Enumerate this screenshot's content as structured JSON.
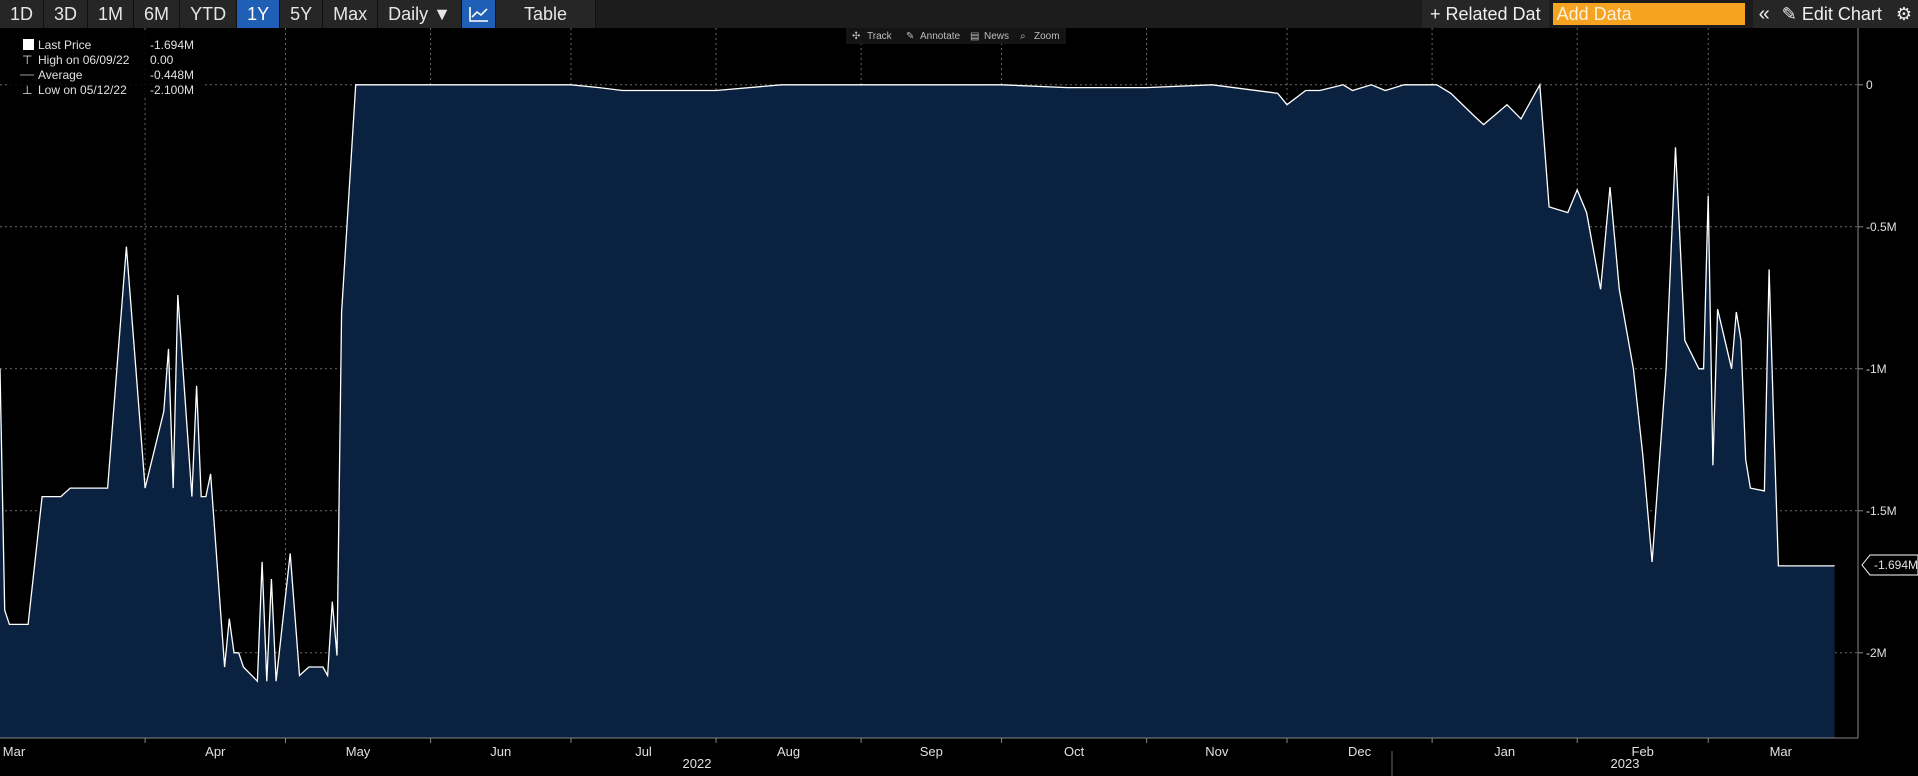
{
  "toolbar": {
    "ranges": [
      "1D",
      "3D",
      "1M",
      "6M",
      "YTD",
      "1Y",
      "5Y",
      "Max"
    ],
    "active_range": "1Y",
    "frequency": "Daily",
    "frequency_arrow": "▼",
    "table_label": "Table",
    "related_label": "+ Related Dat",
    "add_data_placeholder": "Add Data",
    "collapse_icon": "«",
    "edit_chart_label": "Edit Chart",
    "edit_icon": "✎",
    "gear_icon": "⚙"
  },
  "chart_tools": [
    "Track",
    "Annotate",
    "News",
    "Zoom"
  ],
  "legend": {
    "rows": [
      {
        "label": "Last Price",
        "value": "-1.694M"
      },
      {
        "label": "High on 06/09/22",
        "value": "0.00"
      },
      {
        "label": "Average",
        "value": "-0.448M"
      },
      {
        "label": "Low on 05/12/22",
        "value": "-2.100M"
      }
    ]
  },
  "colors": {
    "background": "#000000",
    "area_fill": "#0a2240",
    "line": "#ffffff",
    "grid": "#6a6a6a",
    "accent": "#1f5fb5",
    "add_data": "#f5a320"
  },
  "chart_data": {
    "type": "area",
    "series": [
      {
        "name": "Last Price",
        "x": [
          "2022-03-01",
          "2022-03-02",
          "2022-03-03",
          "2022-03-07",
          "2022-03-10",
          "2022-03-14",
          "2022-03-16",
          "2022-03-21",
          "2022-03-24",
          "2022-03-28",
          "2022-04-01",
          "2022-04-05",
          "2022-04-06",
          "2022-04-07",
          "2022-04-08",
          "2022-04-11",
          "2022-04-12",
          "2022-04-13",
          "2022-04-14",
          "2022-04-15",
          "2022-04-18",
          "2022-04-19",
          "2022-04-20",
          "2022-04-21",
          "2022-04-22",
          "2022-04-25",
          "2022-04-26",
          "2022-04-27",
          "2022-04-28",
          "2022-04-29",
          "2022-05-02",
          "2022-05-04",
          "2022-05-06",
          "2022-05-09",
          "2022-05-10",
          "2022-05-11",
          "2022-05-12",
          "2022-05-13",
          "2022-05-16",
          "2022-05-17",
          "2022-05-18",
          "2022-05-19",
          "2022-05-20",
          "2022-05-23",
          "2022-05-24",
          "2022-05-25",
          "2022-05-26",
          "2022-05-27",
          "2022-05-31",
          "2022-06-01",
          "2022-06-02",
          "2022-06-03",
          "2022-06-06",
          "2022-06-09",
          "2022-07-01",
          "2022-07-07",
          "2022-07-12",
          "2022-08-01",
          "2022-08-15",
          "2022-09-01",
          "2022-09-15",
          "2022-10-01",
          "2022-10-15",
          "2022-11-01",
          "2022-11-15",
          "2022-11-29",
          "2022-12-01",
          "2022-12-05",
          "2022-12-08",
          "2022-12-13",
          "2022-12-15",
          "2022-12-19",
          "2022-12-22",
          "2022-12-26",
          "2022-12-29",
          "2023-01-02",
          "2023-01-05",
          "2023-01-10",
          "2023-01-12",
          "2023-01-17",
          "2023-01-20",
          "2023-01-24",
          "2023-01-26",
          "2023-01-30",
          "2023-02-01",
          "2023-02-03",
          "2023-02-06",
          "2023-02-08",
          "2023-02-10",
          "2023-02-13",
          "2023-02-15",
          "2023-02-17",
          "2023-02-20",
          "2023-02-22",
          "2023-02-24",
          "2023-02-27",
          "2023-02-28",
          "2023-03-01",
          "2023-03-02",
          "2023-03-03",
          "2023-03-06",
          "2023-03-07",
          "2023-03-08",
          "2023-03-09",
          "2023-03-10",
          "2023-03-13",
          "2023-03-14",
          "2023-03-15",
          "2023-03-16",
          "2023-03-17",
          "2023-03-20",
          "2023-03-21",
          "2023-03-22",
          "2023-03-23",
          "2023-03-24",
          "2023-03-27",
          "2023-03-28"
        ],
        "values": [
          -1.0,
          -1.85,
          -1.9,
          -1.9,
          -1.45,
          -1.45,
          -1.42,
          -1.42,
          -1.42,
          -0.57,
          -1.42,
          -1.15,
          -0.93,
          -1.42,
          -0.74,
          -1.45,
          -1.06,
          -1.45,
          -1.45,
          -1.37,
          -2.05,
          -1.88,
          -2.0,
          -2.0,
          -2.05,
          -2.1,
          -1.68,
          -2.1,
          -1.74,
          -2.1,
          -1.65,
          -2.08,
          -2.05,
          -2.05,
          -2.08,
          -1.82,
          -2.01,
          -0.8,
          0.0,
          0.0,
          0.0,
          0.0,
          0.0,
          0.0,
          0.0,
          0.0,
          0.0,
          0.0,
          0.0,
          0.0,
          0.0,
          0.0,
          0.0,
          0.0,
          0.0,
          -0.01,
          -0.02,
          -0.02,
          0.0,
          0.0,
          0.0,
          0.0,
          -0.01,
          -0.01,
          0.0,
          -0.03,
          -0.07,
          -0.02,
          -0.02,
          0.0,
          -0.02,
          0.0,
          -0.02,
          0.0,
          0.0,
          0.0,
          -0.03,
          -0.11,
          -0.14,
          -0.07,
          -0.12,
          0.0,
          -0.43,
          -0.45,
          -0.37,
          -0.45,
          -0.72,
          -0.36,
          -0.72,
          -1.0,
          -1.3,
          -1.68,
          -1.0,
          -0.22,
          -0.9,
          -1.0,
          -1.0,
          -0.39,
          -1.34,
          -0.79,
          -1.0,
          -0.8,
          -0.9,
          -1.32,
          -1.42,
          -1.43,
          -0.65,
          -1.2,
          -1.694,
          -1.694,
          -1.694,
          -1.694,
          -1.694,
          -1.694,
          -1.694,
          -1.694,
          -1.694
        ]
      }
    ],
    "y_ticks": [
      "0",
      "-0.5M",
      "-1M",
      "-1.5M",
      "-2M"
    ],
    "y_tick_values": [
      0,
      -0.5,
      -1.0,
      -1.5,
      -2.0
    ],
    "ylim": [
      -2.3,
      0.2
    ],
    "x_months": [
      "Mar",
      "Apr",
      "May",
      "Jun",
      "Jul",
      "Aug",
      "Sep",
      "Oct",
      "Nov",
      "Dec",
      "Jan",
      "Feb",
      "Mar"
    ],
    "x_years": [
      "2022",
      "2023"
    ],
    "last_value_label": "-1.694M",
    "grid": true,
    "legend_position": "top-left"
  }
}
